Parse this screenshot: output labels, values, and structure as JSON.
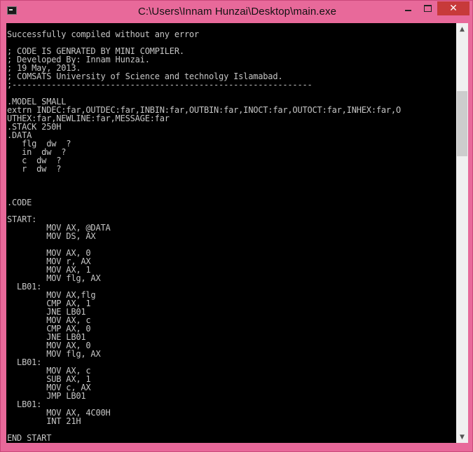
{
  "window": {
    "title": "C:\\Users\\Innam Hunzai\\Desktop\\main.exe",
    "close_glyph": "✕"
  },
  "console": {
    "lines": [
      "Successfully compiled without any error",
      "",
      "; CODE IS GENRATED BY MINI COMPILER.",
      "; Developed By: Innam Hunzai.",
      "; 19 May, 2013.",
      "; COMSATS University of Science and technolgy Islamabad.",
      ";-------------------------------------------------------------",
      "",
      ".MODEL SMALL",
      "extrn INDEC:far,OUTDEC:far,INBIN:far,OUTBIN:far,INOCT:far,OUTOCT:far,INHEX:far,O",
      "UTHEX:far,NEWLINE:far,MESSAGE:far",
      ".STACK 250H",
      ".DATA",
      "   flg  dw  ?",
      "   in  dw  ?",
      "   c  dw  ?",
      "   r  dw  ?",
      "",
      "",
      "",
      ".CODE",
      "",
      "START:",
      "        MOV AX, @DATA",
      "        MOV DS, AX",
      "",
      "        MOV AX, 0",
      "        MOV r, AX",
      "        MOV AX, 1",
      "        MOV flg, AX",
      "  LB01:",
      "        MOV AX,flg",
      "        CMP AX, 1",
      "        JNE LB01",
      "        MOV AX, c",
      "        CMP AX, 0",
      "        JNE LB01",
      "        MOV AX, 0",
      "        MOV flg, AX",
      "  LB01:",
      "        MOV AX, c",
      "        SUB AX, 1",
      "        MOV c, AX",
      "        JMP LB01",
      "  LB01:",
      "        MOV AX, 4C00H",
      "        INT 21H",
      "",
      "END START"
    ]
  },
  "scrollbar": {
    "up_glyph": "▲",
    "down_glyph": "▼"
  },
  "colors": {
    "frame": "#e8699a",
    "console_bg": "#000000",
    "console_text": "#c6c6c6",
    "close_button": "#c73a3a"
  }
}
